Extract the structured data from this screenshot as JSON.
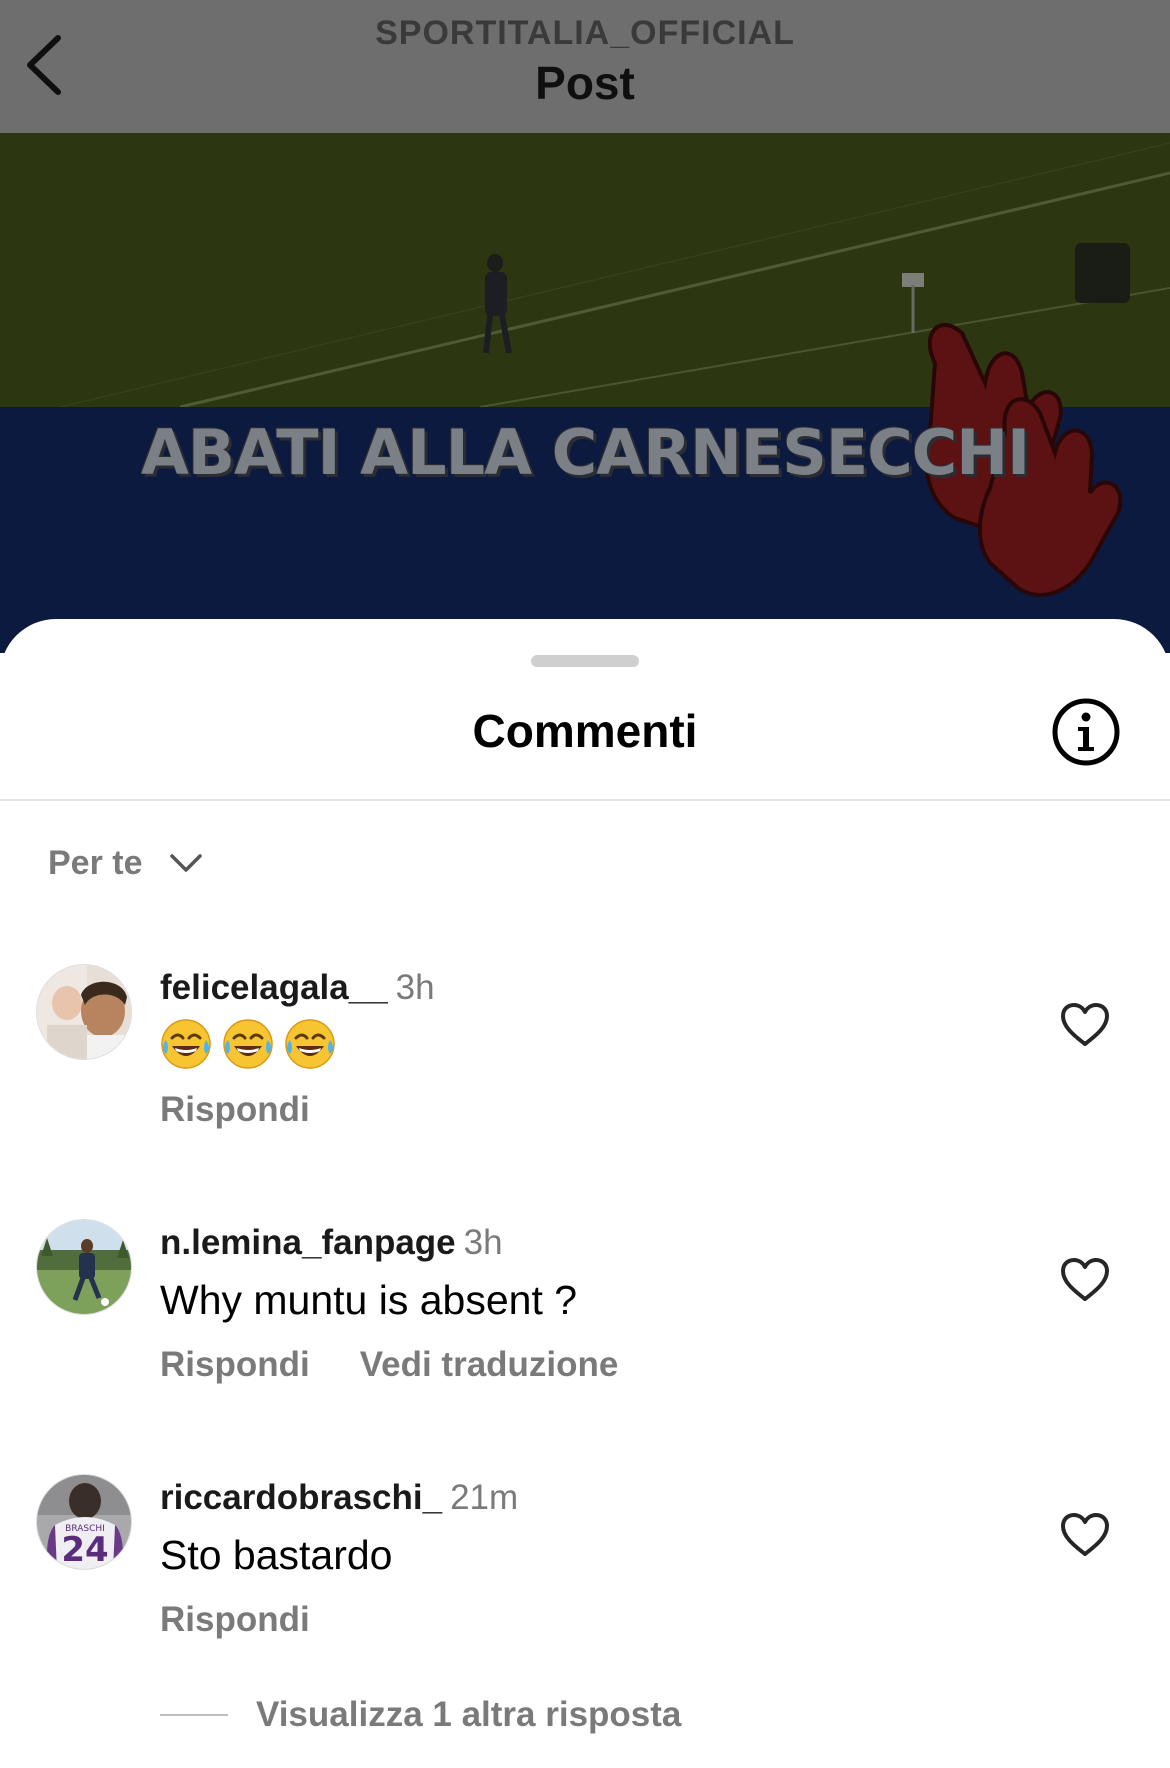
{
  "header": {
    "account": "SPORTITALIA_OFFICIAL",
    "title": "Post"
  },
  "media": {
    "overlay_text": "ABATI ALLA CARNESECCHI"
  },
  "sheet": {
    "title": "Commenti",
    "sort_label": "Per te"
  },
  "comments": [
    {
      "username": "felicelagala__",
      "time": "3h",
      "text": "😂😂😂",
      "reply_label": "Rispondi"
    },
    {
      "username": "n.lemina_fanpage",
      "time": "3h",
      "text": "Why muntu is absent ?",
      "reply_label": "Rispondi",
      "translate_label": "Vedi traduzione"
    },
    {
      "username": "riccardobraschi_",
      "time": "21m",
      "text": "Sto bastardo",
      "reply_label": "Rispondi"
    }
  ],
  "more_replies_label": "Visualizza 1 altra risposta",
  "icons": {
    "back": "chevron-left-icon",
    "info": "info-icon",
    "sort": "chevron-down-icon",
    "like": "heart-icon"
  }
}
